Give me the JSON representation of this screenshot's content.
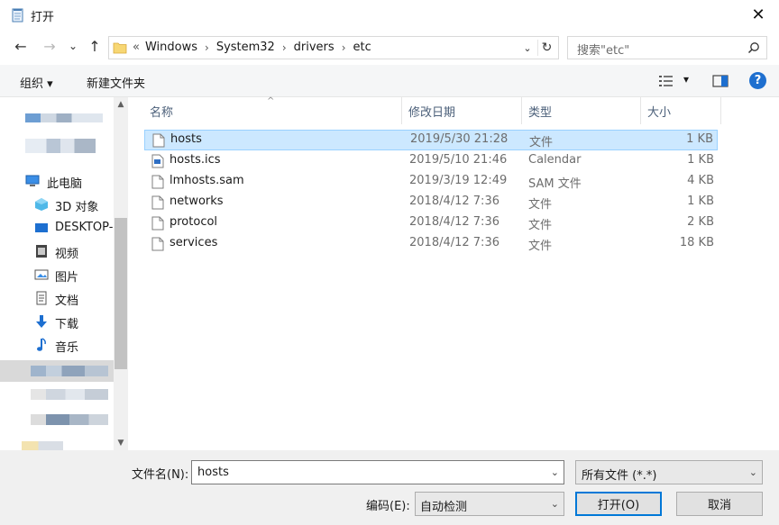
{
  "window": {
    "title": "打开",
    "close": "✕"
  },
  "nav": {
    "back": "←",
    "forward": "→",
    "recent": "⌄",
    "up": "↑",
    "breadcrumb_prefix": "«",
    "breadcrumb": [
      "Windows",
      "System32",
      "drivers",
      "etc"
    ],
    "breadcrumb_sep": "›",
    "dropdown": "⌄",
    "refresh": "↻",
    "search_placeholder": "搜索\"etc\""
  },
  "toolbar": {
    "organize": "组织 ▾",
    "new_folder": "新建文件夹",
    "view_dd": "▾",
    "help": "?"
  },
  "sidebar": {
    "items": [
      {
        "label": "此电脑",
        "icon": "computer-icon"
      },
      {
        "label": "3D 对象",
        "icon": "3d-objects-icon"
      },
      {
        "label": "DESKTOP-",
        "icon": "desktop-icon"
      },
      {
        "label": "视频",
        "icon": "videos-icon"
      },
      {
        "label": "图片",
        "icon": "pictures-icon"
      },
      {
        "label": "文档",
        "icon": "documents-icon"
      },
      {
        "label": "下载",
        "icon": "downloads-icon"
      },
      {
        "label": "音乐",
        "icon": "music-icon"
      }
    ],
    "scroll_up": "▲",
    "scroll_down": "▼"
  },
  "columns": {
    "name": "名称",
    "date": "修改日期",
    "type": "类型",
    "size": "大小",
    "sort_arrow": "^"
  },
  "files": [
    {
      "name": "hosts",
      "date": "2019/5/30 21:28",
      "type": "文件",
      "size": "1 KB",
      "selected": true,
      "icon": "file-icon"
    },
    {
      "name": "hosts.ics",
      "date": "2019/5/10 21:46",
      "type": "Calendar",
      "size": "1 KB",
      "selected": false,
      "icon": "calendar-file-icon"
    },
    {
      "name": "lmhosts.sam",
      "date": "2019/3/19 12:49",
      "type": "SAM 文件",
      "size": "4 KB",
      "selected": false,
      "icon": "file-icon"
    },
    {
      "name": "networks",
      "date": "2018/4/12 7:36",
      "type": "文件",
      "size": "1 KB",
      "selected": false,
      "icon": "file-icon"
    },
    {
      "name": "protocol",
      "date": "2018/4/12 7:36",
      "type": "文件",
      "size": "2 KB",
      "selected": false,
      "icon": "file-icon"
    },
    {
      "name": "services",
      "date": "2018/4/12 7:36",
      "type": "文件",
      "size": "18 KB",
      "selected": false,
      "icon": "file-icon"
    }
  ],
  "bottom": {
    "filename_label": "文件名(N):",
    "filename_value": "hosts",
    "filetype_value": "所有文件  (*.*)",
    "encoding_label": "编码(E):",
    "encoding_value": "自动检测",
    "open_button": "打开(O)",
    "cancel_button": "取消",
    "dropdown": "⌄"
  },
  "colors": {
    "accent": "#0078d7",
    "selection": "#cce8ff",
    "selection_border": "#99d1ff",
    "header_text": "#4c607a"
  }
}
